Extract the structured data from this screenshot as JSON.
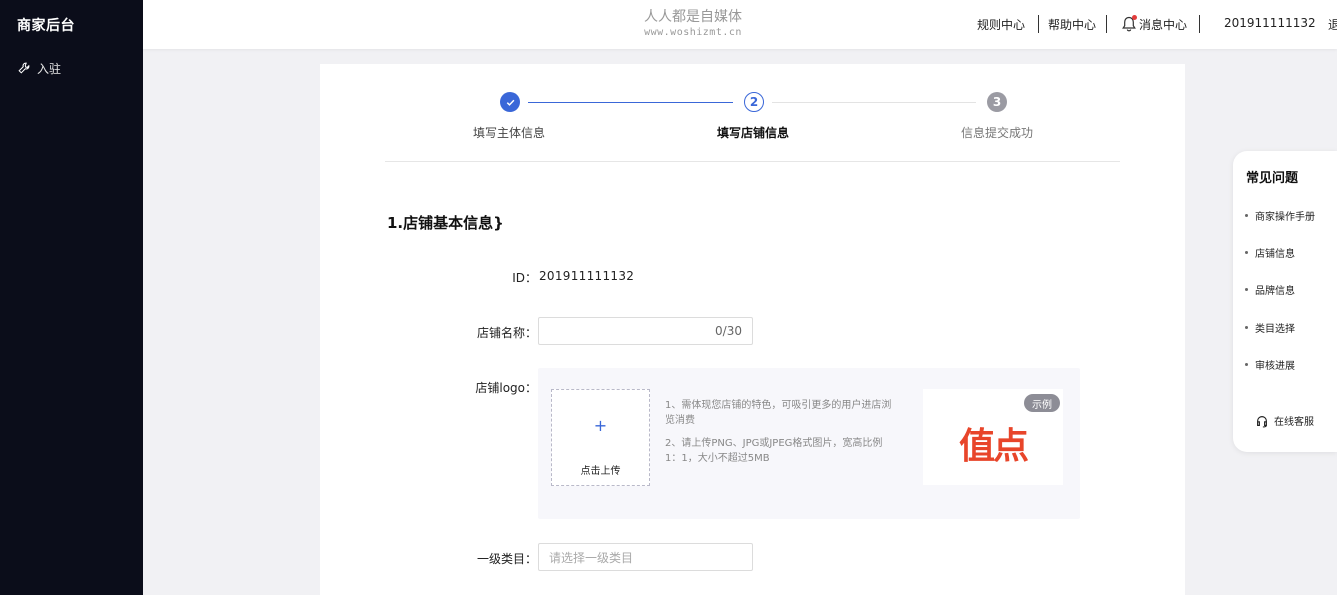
{
  "sidebar": {
    "brand": "商家后台",
    "items": [
      {
        "label": "入驻",
        "icon": "wrench-icon"
      }
    ]
  },
  "header": {
    "watermark": {
      "line1": "人人都是自媒体",
      "line2": "www.woshizmt.cn"
    },
    "nav": [
      "规则中心",
      "帮助中心",
      "消息中心"
    ],
    "user_id": "201911111132",
    "logout": "退"
  },
  "steps": [
    {
      "num": "1",
      "label": "填写主体信息",
      "state": "done"
    },
    {
      "num": "2",
      "label": "填写店铺信息",
      "state": "active"
    },
    {
      "num": "3",
      "label": "信息提交成功",
      "state": "todo"
    }
  ],
  "form": {
    "section_title": "1.店铺基本信息}",
    "id_label": "ID：",
    "id_value": "201911111132",
    "name_label": "店铺名称：",
    "name_counter": "0/30",
    "logo_label": "店铺logo：",
    "upload_plus": "+",
    "upload_label": "点击上传",
    "tip1": "1、需体现您店铺的特色，可吸引更多的用户进店浏览消费",
    "tip2": "2、请上传PNG、JPG或JPEG格式图片，宽高比例1：1，大小不超过5MB",
    "example_badge": "示例",
    "example_logo": "值点",
    "category_label": "一级类目：",
    "category_placeholder": "请选择一级类目"
  },
  "faq": {
    "title": "常见问题",
    "items": [
      "商家操作手册",
      "店铺信息",
      "品牌信息",
      "类目选择",
      "审核进展"
    ],
    "service": "在线客服"
  },
  "colors": {
    "sidebar_bg": "#0b0d1a",
    "accent": "#3a67d8",
    "logo_red": "#e8452a"
  }
}
